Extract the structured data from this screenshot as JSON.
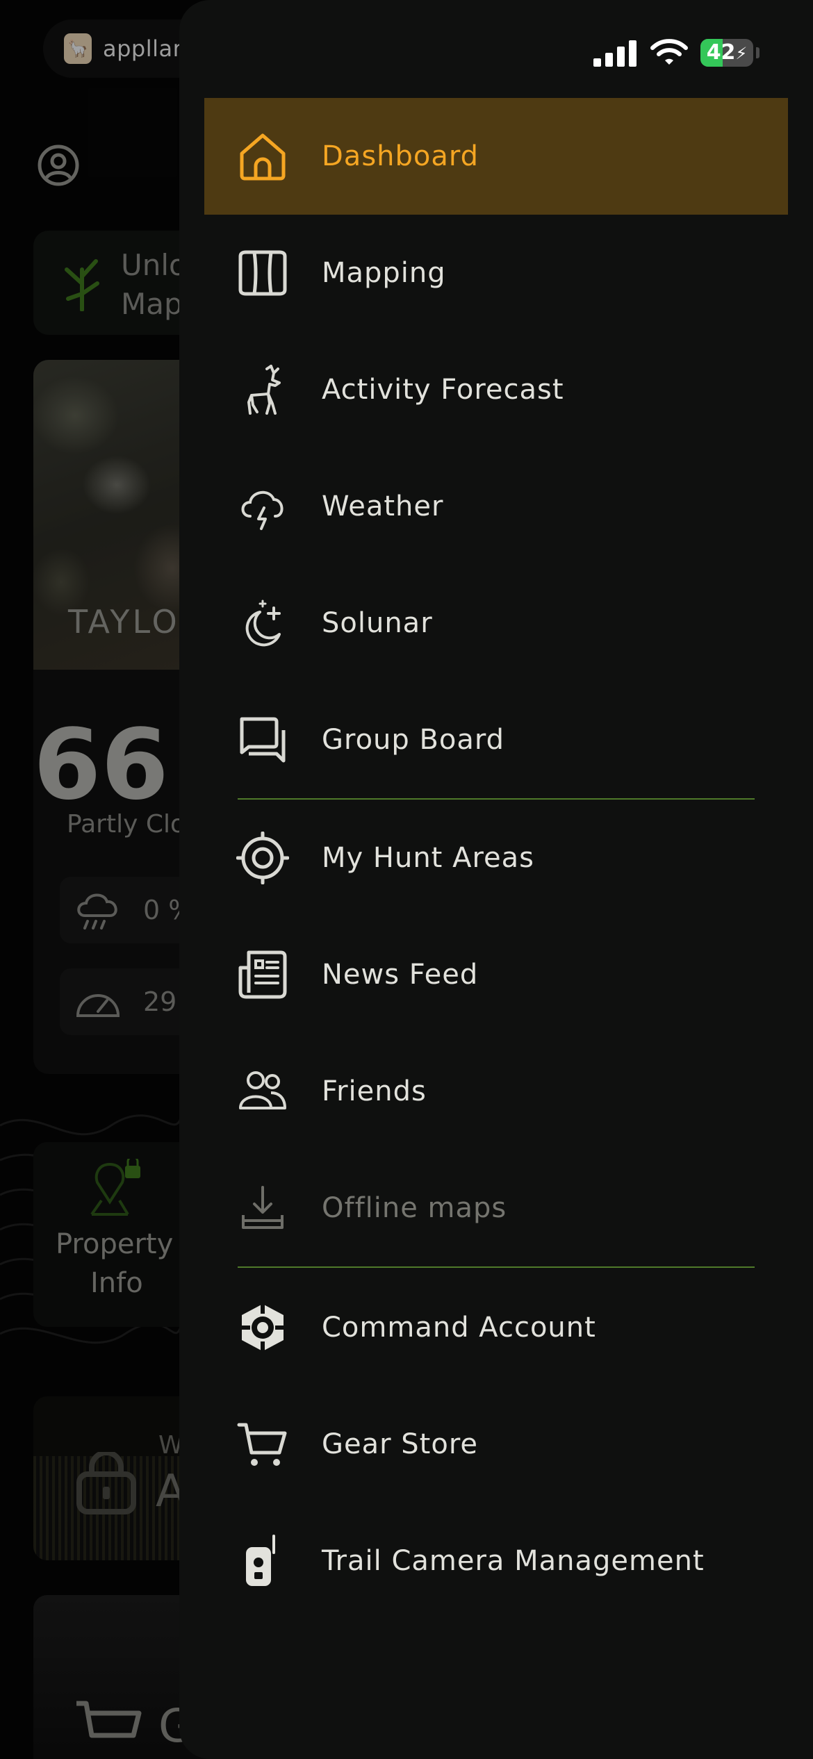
{
  "app_badge": {
    "brand": "appllama"
  },
  "status_bar": {
    "battery_percent": 42,
    "battery_label": "42",
    "charging": true,
    "colors": {
      "battery_fill": "#34c759"
    }
  },
  "background": {
    "unlock_card": {
      "line1": "Unlo",
      "line2": "Map"
    },
    "hero": {
      "location": "TAYLO"
    },
    "weather": {
      "temperature": "66",
      "condition": "Partly Clo",
      "precip": "0 %",
      "pressure": "29"
    },
    "property_card": {
      "line1": "Property",
      "line2": "Info"
    },
    "locked_card": {
      "small": "W",
      "large": "A"
    },
    "store_card": {
      "text": "G"
    }
  },
  "drawer": {
    "colors": {
      "active_bg": "#4e3a12",
      "active_text": "#f5a623",
      "divider": "#4f7a2a",
      "panel": "#0f100f"
    },
    "items": [
      {
        "label": "Dashboard",
        "icon": "home-icon",
        "active": true
      },
      {
        "label": "Mapping",
        "icon": "map-icon"
      },
      {
        "label": "Activity Forecast",
        "icon": "deer-icon"
      },
      {
        "label": "Weather",
        "icon": "storm-cloud-icon"
      },
      {
        "label": "Solunar",
        "icon": "moon-stars-icon"
      },
      {
        "label": "Group Board",
        "icon": "chat-bubbles-icon"
      },
      {
        "label": "My Hunt Areas",
        "icon": "crosshair-icon"
      },
      {
        "label": "News Feed",
        "icon": "newspaper-icon"
      },
      {
        "label": "Friends",
        "icon": "friends-icon"
      },
      {
        "label": "Offline maps",
        "icon": "download-icon",
        "disabled": true
      },
      {
        "label": "Command Account",
        "icon": "command-logo-icon"
      },
      {
        "label": "Gear Store",
        "icon": "cart-icon"
      },
      {
        "label": "Trail Camera Management",
        "icon": "trail-camera-icon"
      }
    ]
  }
}
